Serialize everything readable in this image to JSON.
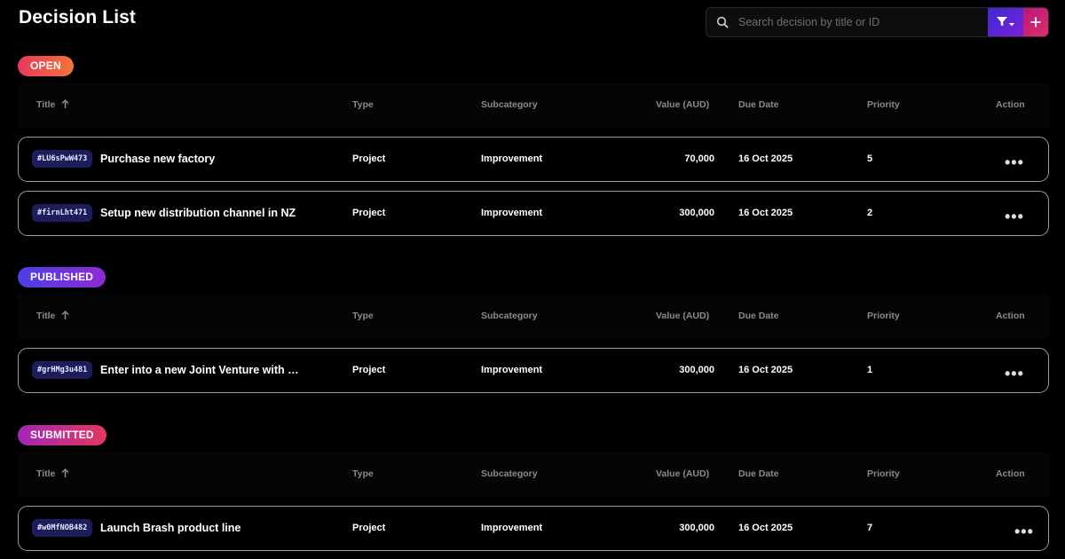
{
  "header": {
    "title": "Decision List",
    "search_placeholder": "Search decision by title or ID"
  },
  "columns": {
    "title": "Title",
    "type": "Type",
    "subcategory": "Subcategory",
    "value": "Value (AUD)",
    "due_date": "Due Date",
    "priority": "Priority",
    "action": "Action"
  },
  "sections": {
    "open": {
      "label": "OPEN",
      "rows": [
        {
          "id": "#LU6sPwW473",
          "title": "Purchase new factory",
          "type": "Project",
          "subcategory": "Improvement",
          "value": "70,000",
          "due": "16 Oct 2025",
          "priority": "5"
        },
        {
          "id": "#firnLht471",
          "title": "Setup new distribution channel in NZ",
          "type": "Project",
          "subcategory": "Improvement",
          "value": "300,000",
          "due": "16 Oct 2025",
          "priority": "2"
        }
      ]
    },
    "published": {
      "label": "PUBLISHED",
      "rows": [
        {
          "id": "#grHMg3u481",
          "title": "Enter into a new Joint Venture with L...",
          "type": "Project",
          "subcategory": "Improvement",
          "value": "300,000",
          "due": "16 Oct 2025",
          "priority": "1"
        }
      ]
    },
    "submitted": {
      "label": "SUBMITTED",
      "rows": [
        {
          "id": "#w0MfNOB482",
          "title": "Launch Brash product line",
          "type": "Project",
          "subcategory": "Improvement",
          "value": "300,000",
          "due": "16 Oct 2025",
          "priority": "7"
        }
      ]
    }
  },
  "icons": {
    "search": "search-icon",
    "filter": "filter-icon",
    "add": "plus-icon",
    "sort": "arrow-up-icon",
    "more": "more-horizontal-icon"
  },
  "colors": {
    "background": "#000000",
    "row_border": "#9a9a9a",
    "id_pill": "#1c1d5a"
  }
}
